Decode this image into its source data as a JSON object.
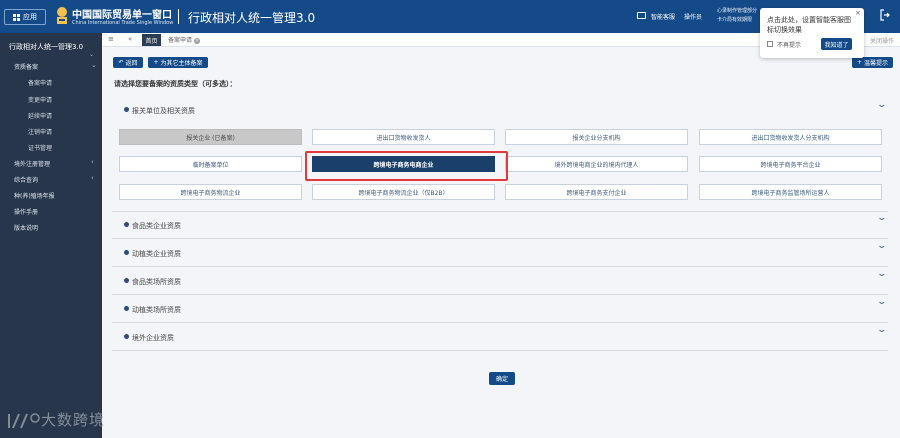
{
  "header": {
    "app_label": "应用",
    "brand_cn": "中国国际贸易单一窗口",
    "brand_en": "China International Trade Single Window",
    "title": "行政相对人统一管理3.0",
    "link_support": "智能客服",
    "link_manual": "操作员",
    "user_line1": "心录制作管理部分",
    "user_line2": "卡介局有效期限"
  },
  "sidebar": {
    "title": "行政相对人统一管理3.0",
    "toggle": "⌄",
    "items": [
      {
        "label": "资质备案",
        "arrow": "⌄"
      },
      {
        "label": "备案申请"
      },
      {
        "label": "变更申请"
      },
      {
        "label": "延续申请"
      },
      {
        "label": "注销申请"
      },
      {
        "label": "证书管理"
      },
      {
        "label": "境外注册管理",
        "arrow": "‹"
      },
      {
        "label": "综合查询",
        "arrow": "‹"
      },
      {
        "label": "种(养)殖场年报"
      },
      {
        "label": "操作手册"
      },
      {
        "label": "版本说明"
      }
    ]
  },
  "tabs": {
    "menu_icon": "≡",
    "back_icon": "«",
    "home": "首页",
    "current": "备案申请",
    "close_all": "关闭操作"
  },
  "toolbar": {
    "return_label": "返回",
    "main_label": "为其它主体备案",
    "help_label": "温馨提示"
  },
  "prompt": "请选择您要备案的资质类型（可多选）：",
  "sections": [
    {
      "title": "报关单位及相关资质"
    },
    {
      "title": "食品类企业资质"
    },
    {
      "title": "动植类企业资质"
    },
    {
      "title": "食品类场所资质"
    },
    {
      "title": "动植类场所资质"
    },
    {
      "title": "境外企业资质"
    }
  ],
  "options": [
    {
      "label": "报关企业 (已备案)",
      "state": "disabled"
    },
    {
      "label": "进出口货物收发货人",
      "state": "normal"
    },
    {
      "label": "报关企业分支机构",
      "state": "normal"
    },
    {
      "label": "进出口货物收发货人分支机构",
      "state": "normal"
    },
    {
      "label": "临时备案单位",
      "state": "normal"
    },
    {
      "label": "跨境电子商务电商企业",
      "state": "selected"
    },
    {
      "label": "境外跨境电商企业的境内代理人",
      "state": "normal"
    },
    {
      "label": "跨境电子商务平台企业",
      "state": "normal"
    },
    {
      "label": "跨境电子商务物流企业",
      "state": "normal"
    },
    {
      "label": "跨境电子商务物流企业（仅B2B）",
      "state": "normal"
    },
    {
      "label": "跨境电子商务支付企业",
      "state": "normal"
    },
    {
      "label": "跨境电子商务监管场所运营人",
      "state": "normal"
    }
  ],
  "confirm_label": "确定",
  "popup": {
    "text": "点击此处，设置智能客服图标切换效果",
    "close": "×",
    "no_remind": "不再提示",
    "ok": "我知道了"
  },
  "watermark": "大数跨境",
  "colors": {
    "header_bg": "#144a87",
    "sidebar_bg": "#27364a",
    "selected_bg": "#1a3f6a",
    "highlight_outline": "#e23a3a"
  }
}
